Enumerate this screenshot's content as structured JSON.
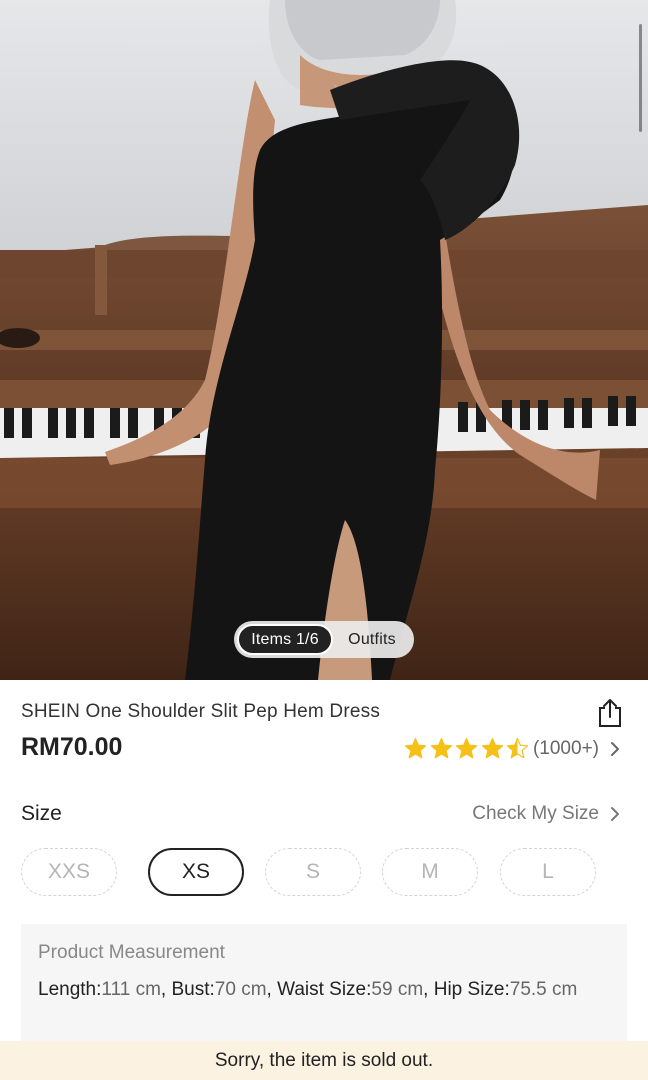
{
  "gallery": {
    "image_alt": "Model wearing black one shoulder dress leaning on piano",
    "tabs": [
      {
        "label": "Items 1/6",
        "active": true
      },
      {
        "label": "Outfits",
        "active": false
      }
    ]
  },
  "product": {
    "title": "SHEIN One Shoulder Slit Pep Hem Dress",
    "price": "RM70.00",
    "rating": {
      "stars": 4.5,
      "count_label": "(1000+)"
    },
    "share_icon": "share-icon"
  },
  "size_section": {
    "label": "Size",
    "check_link": "Check My Size",
    "options": [
      {
        "label": "XXS",
        "selected": false
      },
      {
        "label": "XS",
        "selected": true
      },
      {
        "label": "S",
        "selected": false
      },
      {
        "label": "M",
        "selected": false
      },
      {
        "label": "L",
        "selected": false
      }
    ]
  },
  "measurement": {
    "title": "Product Measurement",
    "items": [
      {
        "key": "Length:",
        "value": "111 cm"
      },
      {
        "key": "Bust:",
        "value": "70 cm"
      },
      {
        "key": "Waist Size:",
        "value": "59 cm"
      },
      {
        "key": "Hip Size:",
        "value": "75.5 cm"
      }
    ]
  },
  "banner": {
    "text": "Sorry, the item is sold out."
  },
  "colors": {
    "star": "#f5c116",
    "banner_bg": "#fbf2e1",
    "text": "#222222",
    "muted": "#777777"
  }
}
